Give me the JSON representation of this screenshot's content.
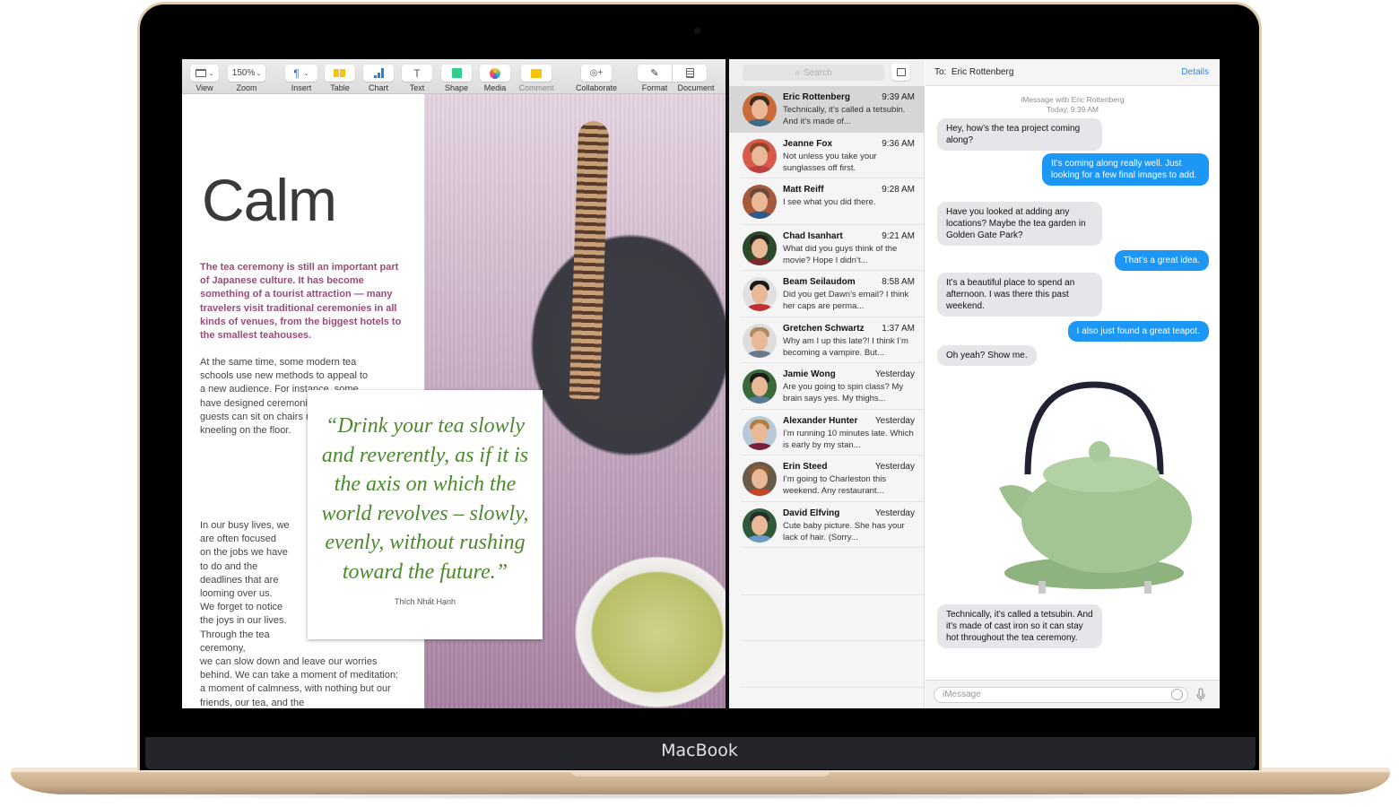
{
  "device": {
    "brand_label": "MacBook"
  },
  "pages": {
    "toolbar": {
      "items": [
        {
          "label": "View",
          "icon": "sidebar-view-icon",
          "value": ""
        },
        {
          "label": "Zoom",
          "icon": "",
          "value": "150%"
        },
        {
          "label": "Insert",
          "icon": "paragraph-icon",
          "value": "¶"
        },
        {
          "label": "Table",
          "icon": "table-icon",
          "value": ""
        },
        {
          "label": "Chart",
          "icon": "chart-icon",
          "value": ""
        },
        {
          "label": "Text",
          "icon": "text-icon",
          "value": "T"
        },
        {
          "label": "Shape",
          "icon": "shape-icon",
          "value": ""
        },
        {
          "label": "Media",
          "icon": "media-icon",
          "value": ""
        },
        {
          "label": "Comment",
          "icon": "comment-icon",
          "value": ""
        },
        {
          "label": "Collaborate",
          "icon": "collaborate-icon",
          "value": ""
        },
        {
          "label": "Format",
          "icon": "format-brush-icon",
          "value": ""
        },
        {
          "label": "Document",
          "icon": "document-icon",
          "value": ""
        }
      ]
    },
    "document": {
      "title": "Calm",
      "lead": "The tea ceremony is still an important part of Japanese culture. It has become something of a tourist attraction — many travelers visit traditional ceremonies in all kinds of venues, from the biggest hotels to the smallest teahouses.",
      "body1": "At the same time, some modern tea schools use new methods to appeal to a new audience. For instance, some have designed ceremonies where guests can sit on chairs rather than kneeling on the floor.",
      "body2_narrow": "In our busy lives, we are often focused on the jobs we have to do and the deadlines that are looming over us. We forget to notice the joys in our lives. Through the tea ceremony,",
      "body2_wide": "we can slow down and leave our worries behind. We can take a moment of meditation: a moment of calmness, with nothing but our friends, our tea, and the",
      "quote": "“Drink your tea slowly and reverently, as if it is the axis on which the world revolves – slowly, evenly, without rushing toward the future.”",
      "quote_author": "Thích Nhất Hạnh"
    },
    "colors": {
      "lead_text": "#9a4c74",
      "quote_text": "#4a8a2c"
    }
  },
  "messages": {
    "search_placeholder": "Search",
    "conversations": [
      {
        "name": "Eric Rottenberg",
        "time": "9:39 AM",
        "preview": "Technically, it’s called a tetsubin. And it’s made of...",
        "selected": true
      },
      {
        "name": "Jeanne Fox",
        "time": "9:36 AM",
        "preview": "Not unless you take your sunglasses off first."
      },
      {
        "name": "Matt Reiff",
        "time": "9:28 AM",
        "preview": "I see what you did there."
      },
      {
        "name": "Chad Isanhart",
        "time": "9:21 AM",
        "preview": "What did you guys think of the movie? Hope I didn’t..."
      },
      {
        "name": "Beam Seilaudom",
        "time": "8:58 AM",
        "preview": "Did you get Dawn’s email? I think her caps are perma..."
      },
      {
        "name": "Gretchen Schwartz",
        "time": "1:37 AM",
        "preview": "Why am I up this late?! I think I’m becoming a vampire. But..."
      },
      {
        "name": "Jamie Wong",
        "time": "Yesterday",
        "preview": "Are you going to spin class? My brain says yes. My thighs..."
      },
      {
        "name": "Alexander Hunter",
        "time": "Yesterday",
        "preview": "I’m running 10 minutes late. Which is early by my stan..."
      },
      {
        "name": "Erin Steed",
        "time": "Yesterday",
        "preview": "I’m going to Charleston this weekend. Any restaurant..."
      },
      {
        "name": "David Elfving",
        "time": "Yesterday",
        "preview": "Cute baby picture. She has your lack of hair. (Sorry..."
      }
    ],
    "chat": {
      "to_label": "To:",
      "recipient": "Eric Rottenberg",
      "details_label": "Details",
      "meta_line1": "iMessage with  Eric Rottenberg",
      "meta_line2": "Today, 9:39 AM",
      "bubbles": [
        {
          "dir": "in",
          "text": "Hey, how’s the tea project coming along?"
        },
        {
          "dir": "out",
          "text": "It’s coming along really well. Just looking for a few final images to add."
        },
        {
          "dir": "in",
          "text": "Have you looked at adding any locations? Maybe the tea garden in Golden Gate Park?"
        },
        {
          "dir": "out",
          "text": "That’s a great idea."
        },
        {
          "dir": "in",
          "text": "It’s a beautiful place to spend an afternoon. I was there this past weekend."
        },
        {
          "dir": "out",
          "text": "I also just found a great teapot."
        },
        {
          "dir": "in",
          "text": "Oh yeah? Show me."
        },
        {
          "dir": "in",
          "text": "Technically, it’s called a tetsubin. And it’s made of cast iron so it can stay hot throughout the tea ceremony."
        }
      ],
      "input_placeholder": "iMessage"
    },
    "colors": {
      "accent": "#2c86e6",
      "out_bubble": "#1c97f5",
      "in_bubble": "#e5e5ea"
    }
  }
}
